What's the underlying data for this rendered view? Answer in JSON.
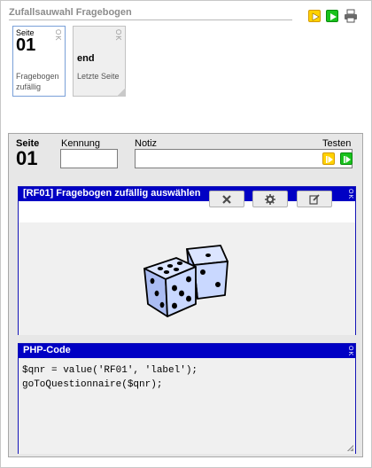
{
  "title": "Zufallsauwahl Fragebogen",
  "pages": [
    {
      "seite_label": "Seite",
      "number": "01",
      "description": "Fragebogen zufällig",
      "ok": "OK"
    },
    {
      "code": "end",
      "description": "Letzte Seite",
      "ok": "OK"
    }
  ],
  "panel": {
    "seite_label": "Seite",
    "number": "01",
    "kennung_label": "Kennung",
    "kennung_value": "",
    "notiz_label": "Notiz",
    "notiz_value": "",
    "testen_label": "Testen"
  },
  "question": {
    "header": "[RF01] Fragebogen zufällig auswählen",
    "ok": "OK",
    "icons": [
      "close-icon",
      "gear-icon",
      "edit-icon",
      "dice-icon"
    ]
  },
  "php": {
    "header": "PHP-Code",
    "ok": "OK",
    "lines": [
      "$qnr = value('RF01', 'label');",
      "goToQuestionnaire($qnr);"
    ]
  },
  "colors": {
    "accent_blue": "#0000c4",
    "play_yellow": "#ffd200",
    "play_green": "#18c21c",
    "dice_blue": "#c9d8ff"
  }
}
